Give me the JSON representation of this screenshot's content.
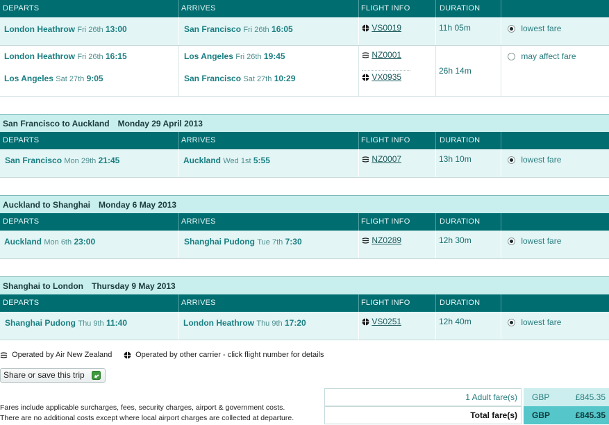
{
  "headers": {
    "departs": "DEPARTS",
    "arrives": "ARRIVES",
    "flight_info": "FLIGHT INFO",
    "duration": "DURATION"
  },
  "segments": [
    {
      "rows": [
        {
          "dep_city": "London Heathrow",
          "dep_day": "Fri 26th",
          "dep_time": "13:00",
          "arr_city": "San Francisco",
          "arr_day": "Fri 26th",
          "arr_time": "16:05",
          "flight": "VS0019",
          "carrier": "other",
          "duration": "11h 05m",
          "fare_label": "lowest fare",
          "selected": true
        }
      ]
    },
    {
      "rows": [
        {
          "dep_city": "London Heathrow",
          "dep_day": "Fri 26th",
          "dep_time": "16:15",
          "arr_city": "Los Angeles",
          "arr_day": "Fri 26th",
          "arr_time": "19:45",
          "flight": "NZ0001",
          "carrier": "nz"
        },
        {
          "dep_city": "Los Angeles",
          "dep_day": "Sat 27th",
          "dep_time": "9:05",
          "arr_city": "San Francisco",
          "arr_day": "Sat 27th",
          "arr_time": "10:29",
          "flight": "VX0935",
          "carrier": "other"
        }
      ],
      "duration": "26h 14m",
      "fare_label": "may affect fare",
      "selected": false
    },
    {
      "title": "San Francisco to Auckland",
      "date": "Monday 29 April 2013",
      "rows": [
        {
          "dep_city": "San Francisco",
          "dep_day": "Mon 29th",
          "dep_time": "21:45",
          "arr_city": "Auckland",
          "arr_day": "Wed 1st",
          "arr_time": "5:55",
          "flight": "NZ0007",
          "carrier": "nz",
          "duration": "13h 10m",
          "fare_label": "lowest fare",
          "selected": true
        }
      ]
    },
    {
      "title": "Auckland to Shanghai",
      "date": "Monday 6 May 2013",
      "rows": [
        {
          "dep_city": "Auckland",
          "dep_day": "Mon 6th",
          "dep_time": "23:00",
          "arr_city": "Shanghai Pudong",
          "arr_day": "Tue 7th",
          "arr_time": "7:30",
          "flight": "NZ0289",
          "carrier": "nz",
          "duration": "12h 30m",
          "fare_label": "lowest fare",
          "selected": true
        }
      ]
    },
    {
      "title": "Shanghai to London",
      "date": "Thursday 9 May 2013",
      "rows": [
        {
          "dep_city": "Shanghai Pudong",
          "dep_day": "Thu 9th",
          "dep_time": "11:40",
          "arr_city": "London Heathrow",
          "arr_day": "Thu 9th",
          "arr_time": "17:20",
          "flight": "VS0251",
          "carrier": "other",
          "duration": "12h 40m",
          "fare_label": "lowest fare",
          "selected": true
        }
      ]
    }
  ],
  "legend": {
    "nz": "Operated by Air New Zealand",
    "other": "Operated by other carrier - click flight number for details"
  },
  "share_button": "Share or save this trip",
  "notes": [
    "Fares include applicable surcharges, fees, security charges, airport & government costs.",
    "There are no additional costs except where local airport charges are collected at departure."
  ],
  "fares": {
    "adult_label": "1 Adult fare(s)",
    "adult_currency": "GBP",
    "adult_amount": "£845.35",
    "total_label": "Total fare(s)",
    "total_currency": "GBP",
    "total_amount": "£845.35"
  }
}
